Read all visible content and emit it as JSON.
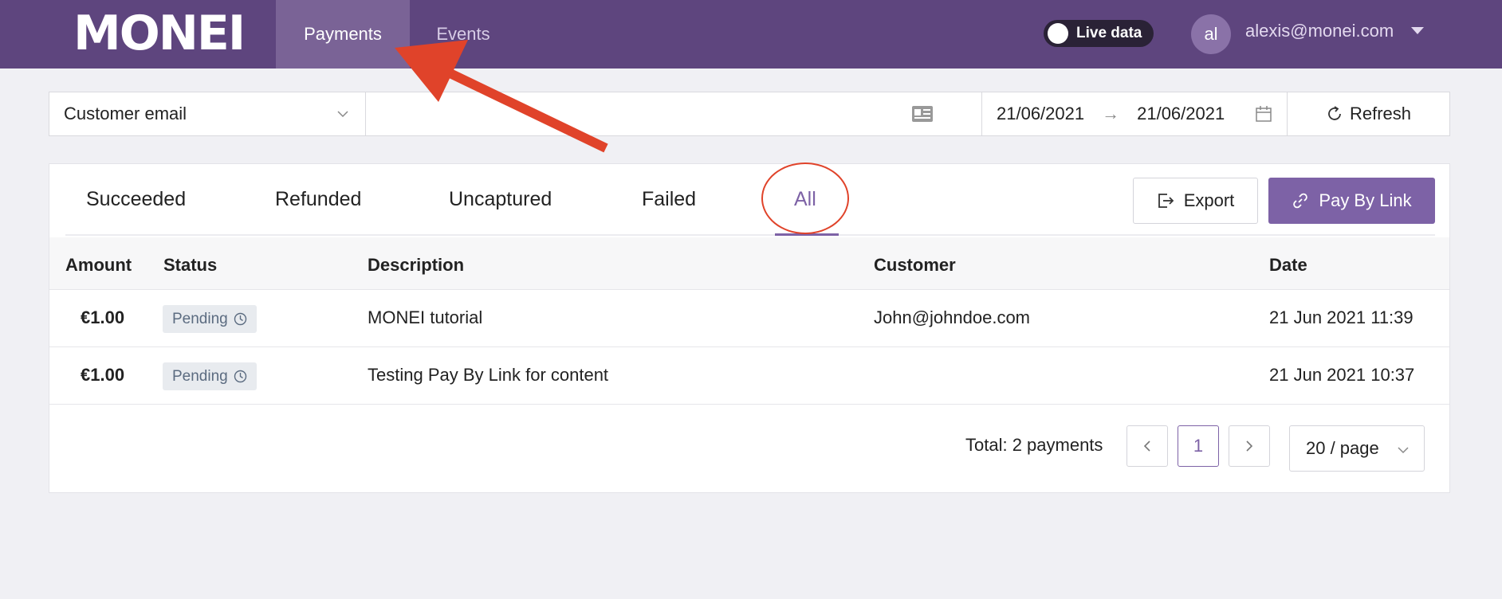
{
  "header": {
    "logo": "MONEI",
    "nav": [
      {
        "label": "Payments",
        "active": true
      },
      {
        "label": "Events",
        "active": false
      }
    ],
    "live_toggle_label": "Live data",
    "avatar_initials": "al",
    "user_email": "alexis@monei.com"
  },
  "filters": {
    "field_select": "Customer email",
    "search_value": "",
    "date_from": "21/06/2021",
    "date_arrow": "→",
    "date_to": "21/06/2021",
    "refresh_label": "Refresh"
  },
  "tabs": [
    {
      "label": "Succeeded",
      "active": false
    },
    {
      "label": "Refunded",
      "active": false
    },
    {
      "label": "Uncaptured",
      "active": false
    },
    {
      "label": "Failed",
      "active": false
    },
    {
      "label": "All",
      "active": true
    }
  ],
  "actions": {
    "export_label": "Export",
    "pay_by_link_label": "Pay By Link"
  },
  "table": {
    "columns": [
      "Amount",
      "Status",
      "Description",
      "Customer",
      "Date"
    ],
    "rows": [
      {
        "amount": "€1.00",
        "status": "Pending",
        "description": "MONEI tutorial",
        "customer": "John@johndoe.com",
        "date": "21 Jun 2021 11:39"
      },
      {
        "amount": "€1.00",
        "status": "Pending",
        "description": "Testing Pay By Link for content",
        "customer": "",
        "date": "21 Jun 2021 10:37"
      }
    ]
  },
  "pagination": {
    "total_label": "Total: 2 payments",
    "current_page": "1",
    "page_size_label": "20 / page"
  },
  "colors": {
    "header_bg": "#5e457e",
    "accent": "#7d62a6",
    "annotation": "#e0432a"
  }
}
